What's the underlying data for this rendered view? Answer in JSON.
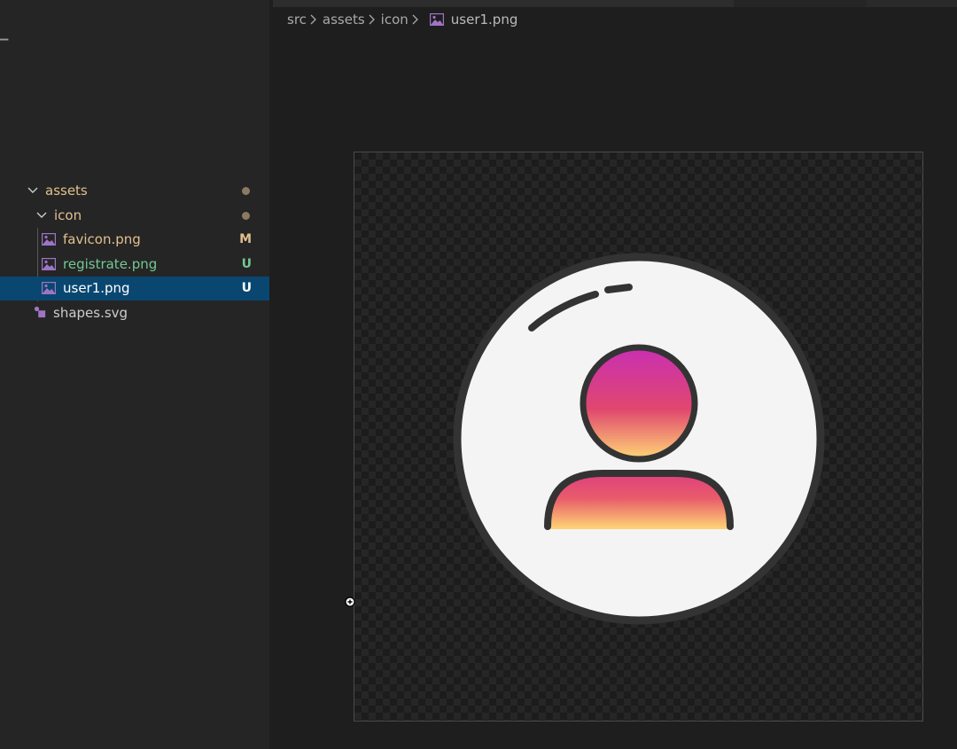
{
  "breadcrumb": {
    "items": [
      "src",
      "assets",
      "icon"
    ],
    "file": "user1.png",
    "separator": ">"
  },
  "explorer": {
    "rows": [
      {
        "label": "assets",
        "kind": "folder",
        "expanded": true,
        "decoration": "dot"
      },
      {
        "label": "icon",
        "kind": "folder",
        "expanded": true,
        "decoration": "dot"
      },
      {
        "label": "favicon.png",
        "kind": "image-file",
        "status": "M"
      },
      {
        "label": "registrate.png",
        "kind": "image-file",
        "status": "U"
      },
      {
        "label": "user1.png",
        "kind": "image-file",
        "status": "U",
        "selected": true
      },
      {
        "label": "shapes.svg",
        "kind": "svg-file"
      }
    ]
  },
  "preview": {
    "file": "user1.png",
    "icon_name": "user-avatar-icon",
    "colors": {
      "gradient_top": "#c92fb3",
      "gradient_mid": "#e0476e",
      "gradient_bottom": "#ffd676",
      "outline": "#333333",
      "background": "#f4f4f4"
    }
  },
  "colors": {
    "modified": "#e2c08d",
    "untracked": "#73c991",
    "selection": "#094771",
    "image_icon": "#a074c4"
  }
}
